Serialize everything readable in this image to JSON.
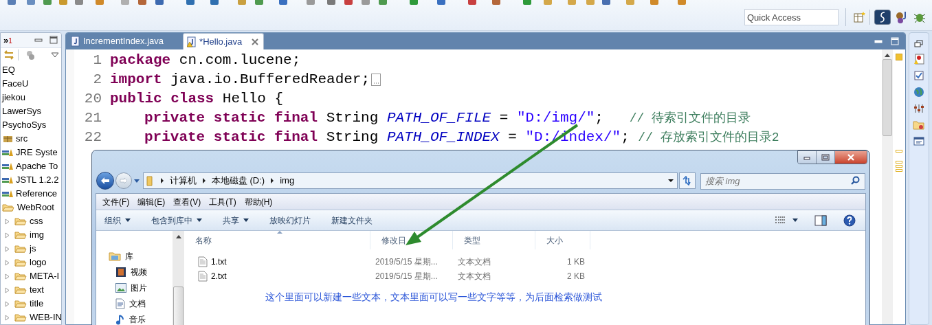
{
  "toolbar": {
    "quick_access": {
      "placeholder": "Quick Access"
    }
  },
  "package_explorer": {
    "overflow": {
      "label": "»",
      "count": "1"
    },
    "items": [
      {
        "label": "EQ",
        "kind": "project"
      },
      {
        "label": "FaceU",
        "kind": "project"
      },
      {
        "label": "jiekou",
        "kind": "project"
      },
      {
        "label": "LawerSys",
        "kind": "project"
      },
      {
        "label": "PsychoSys",
        "kind": "project"
      },
      {
        "label": "src",
        "kind": "package"
      },
      {
        "label": "JRE Syste",
        "kind": "library"
      },
      {
        "label": "Apache To",
        "kind": "library"
      },
      {
        "label": "JSTL 1.2.2",
        "kind": "library"
      },
      {
        "label": "Reference",
        "kind": "library"
      },
      {
        "label": "WebRoot",
        "kind": "folder",
        "expanded": true,
        "children": [
          {
            "label": "css",
            "kind": "folder",
            "expanded": false
          },
          {
            "label": "img",
            "kind": "folder",
            "expanded": false
          },
          {
            "label": "js",
            "kind": "folder",
            "expanded": false
          },
          {
            "label": "logo",
            "kind": "folder",
            "expanded": false
          },
          {
            "label": "META-I",
            "kind": "folder",
            "expanded": false
          },
          {
            "label": "text",
            "kind": "folder",
            "expanded": false
          },
          {
            "label": "title",
            "kind": "folder",
            "expanded": false
          },
          {
            "label": "WEB-IN",
            "kind": "folder",
            "expanded": false
          }
        ]
      }
    ]
  },
  "editor": {
    "tabs": [
      {
        "label": "IncrementIndex.java",
        "selected": false,
        "warning": false
      },
      {
        "label": "*Hello.java",
        "selected": true,
        "warning": true
      }
    ],
    "lines": [
      {
        "number": "1",
        "tokens": [
          {
            "kind": "keyword",
            "text": "package"
          },
          {
            "kind": "plain",
            "text": " cn.com.lucene;"
          }
        ]
      },
      {
        "number": "2",
        "folded": true,
        "tokens": [
          {
            "kind": "keyword",
            "text": "import"
          },
          {
            "kind": "plain",
            "text": " java.io.BufferedReader;"
          }
        ]
      },
      {
        "number": "20",
        "tokens": [
          {
            "kind": "keyword",
            "text": "public class"
          },
          {
            "kind": "plain",
            "text": " Hello {"
          }
        ]
      },
      {
        "number": "21",
        "indented": true,
        "tokens": [
          {
            "kind": "keyword",
            "text": "private static final"
          },
          {
            "kind": "plain",
            "text": " String "
          },
          {
            "kind": "field",
            "text": "PATH_OF_FILE"
          },
          {
            "kind": "plain",
            "text": " = "
          },
          {
            "kind": "string",
            "text": "\"D:/img/\""
          },
          {
            "kind": "plain",
            "text": ";   "
          },
          {
            "kind": "comment",
            "text": "// 待索引文件的目录"
          }
        ]
      },
      {
        "number": "22",
        "indented": true,
        "tokens": [
          {
            "kind": "keyword",
            "text": "private static final"
          },
          {
            "kind": "plain",
            "text": " String "
          },
          {
            "kind": "field",
            "text": "PATH_OF_INDEX"
          },
          {
            "kind": "plain",
            "text": " = "
          },
          {
            "kind": "string",
            "text": "\"D:/index/\""
          },
          {
            "kind": "plain",
            "text": "; "
          },
          {
            "kind": "comment",
            "text": "// 存放索引文件的目录2"
          }
        ]
      }
    ]
  },
  "file_explorer": {
    "breadcrumbs": [
      "计算机",
      "本地磁盘 (D:)",
      "img"
    ],
    "search": {
      "placeholder": "搜索 img"
    },
    "menu": [
      "文件(F)",
      "编辑(E)",
      "查看(V)",
      "工具(T)",
      "帮助(H)"
    ],
    "commands": [
      {
        "label": "组织",
        "dropdown": true
      },
      {
        "label": "包含到库中",
        "dropdown": true
      },
      {
        "label": "共享",
        "dropdown": true
      },
      {
        "label": "放映幻灯片",
        "dropdown": false
      },
      {
        "label": "新建文件夹",
        "dropdown": false
      }
    ],
    "nav": [
      {
        "label": "库",
        "kind": "library",
        "children": [
          {
            "label": "视频",
            "kind": "video"
          },
          {
            "label": "图片",
            "kind": "pictures"
          },
          {
            "label": "文档",
            "kind": "documents"
          },
          {
            "label": "音乐",
            "kind": "music"
          }
        ]
      }
    ],
    "columns": [
      "名称",
      "修改日",
      "类型",
      "大小"
    ],
    "files": [
      {
        "name": "1.txt",
        "modified": "2019/5/15 星期...",
        "type": "文本文档",
        "size": "1 KB"
      },
      {
        "name": "2.txt",
        "modified": "2019/5/15 星期...",
        "type": "文本文档",
        "size": "2 KB"
      }
    ]
  },
  "annotation": {
    "note": "这个里面可以新建一些文本，文本里面可以写一些文字等等，为后面检索做测试"
  }
}
